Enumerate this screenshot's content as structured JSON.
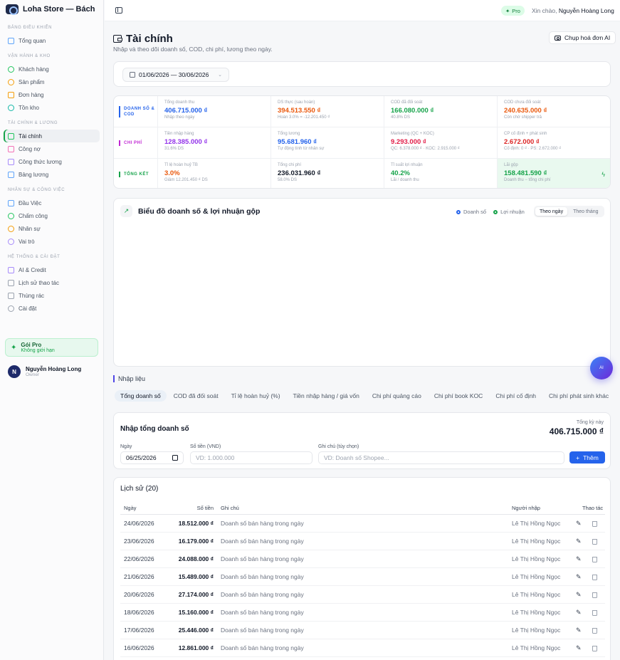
{
  "brand": {
    "name": "Loha Store — Bách hóa ..."
  },
  "sidebar": {
    "sections": [
      {
        "title": "Bảng điều khiển",
        "items": [
          {
            "label": "Tổng quan",
            "icon": "layout-grid-icon"
          }
        ]
      },
      {
        "title": "Vận hành & kho",
        "items": [
          {
            "label": "Khách hàng",
            "icon": "users-icon"
          },
          {
            "label": "Sản phẩm",
            "icon": "box-icon"
          },
          {
            "label": "Đơn hàng",
            "icon": "shopping-bag-icon"
          },
          {
            "label": "Tồn kho",
            "icon": "warehouse-icon"
          }
        ]
      },
      {
        "title": "Tài chính & lương",
        "items": [
          {
            "label": "Tài chính",
            "icon": "wallet-icon",
            "active": true
          },
          {
            "label": "Công nợ",
            "icon": "credit-card-icon"
          },
          {
            "label": "Công thức lương",
            "icon": "calculator-icon"
          },
          {
            "label": "Bảng lương",
            "icon": "receipt-icon"
          }
        ]
      },
      {
        "title": "Nhân sự & công việc",
        "items": [
          {
            "label": "Đầu Việc",
            "icon": "checkbox-icon"
          },
          {
            "label": "Chấm công",
            "icon": "clock-icon"
          },
          {
            "label": "Nhân sự",
            "icon": "user-icon"
          },
          {
            "label": "Vai trò",
            "icon": "shield-icon"
          }
        ]
      },
      {
        "title": "Hệ thống & cài đặt",
        "items": [
          {
            "label": "AI & Credit",
            "icon": "sparkle-icon"
          },
          {
            "label": "Lịch sử thao tác",
            "icon": "history-icon"
          },
          {
            "label": "Thùng rác",
            "icon": "trash-icon"
          },
          {
            "label": "Cài đặt",
            "icon": "gear-icon"
          }
        ]
      }
    ],
    "pro": {
      "title": "Gói Pro",
      "subtitle": "Không giới hạn"
    },
    "user": {
      "initial": "N",
      "name": "Nguyễn Hoàng Long",
      "role": "Owner"
    }
  },
  "topbar": {
    "badge": "Pro",
    "greeting": "Xin chào,",
    "username": "Nguyễn Hoàng Long"
  },
  "page": {
    "title": "Tài chính",
    "subtitle": "Nhập và theo dõi doanh số, COD, chi phí, lương theo ngày.",
    "ai_button": "Chụp hoá đơn AI",
    "date_range": "01/06/2026 — 30/06/2026"
  },
  "summary": [
    {
      "label": "Doanh số & COD",
      "color": "#2563eb",
      "cells": [
        {
          "label": "Tổng doanh thu",
          "value": "406.715.000 ₫",
          "note": "Nhập theo ngày",
          "color": "#2563eb"
        },
        {
          "label": "DS thực (sau hoàn)",
          "value": "394.513.550 ₫",
          "note": "Hoàn 3.0% = -12.201.450 ₫",
          "color": "#ea580c"
        },
        {
          "label": "COD đã đối soát",
          "value": "166.080.000 ₫",
          "note": "40.8% DS",
          "color": "#16a34a"
        },
        {
          "label": "COD chưa đối soát",
          "value": "240.635.000 ₫",
          "note": "Còn chờ shipper trả",
          "color": "#ea580c"
        }
      ]
    },
    {
      "label": "Chi phí",
      "color": "#c026d3",
      "cells": [
        {
          "label": "Tiền nhập hàng",
          "value": "128.385.000 ₫",
          "note": "31.6% DS",
          "color": "#9333ea"
        },
        {
          "label": "Tổng lương",
          "value": "95.681.960 ₫",
          "note": "Tự động tính từ nhân sự",
          "color": "#2563eb"
        },
        {
          "label": "Marketing (QC + KOC)",
          "value": "9.293.000 ₫",
          "note": "QC: 6.378.000 ₫ · KOC: 2.915.000 ₫",
          "color": "#e11d48"
        },
        {
          "label": "CP cố định + phát sinh",
          "value": "2.672.000 ₫",
          "note": "Cố định: 0 ₫ · PS: 2.672.000 ₫",
          "color": "#dc2626"
        }
      ]
    },
    {
      "label": "Tổng kết",
      "color": "#16a34a",
      "cells": [
        {
          "label": "Tỉ lệ hoàn huỷ TB",
          "value": "3.0%",
          "note": "Giảm 12.201.450 ₫ DS",
          "color": "#ea580c"
        },
        {
          "label": "Tổng chi phí",
          "value": "236.031.960 ₫",
          "note": "58.0% DS",
          "color": "#111827"
        },
        {
          "label": "Tỉ suất lợi nhuận",
          "value": "40.2%",
          "note": "Lãi / doanh thu",
          "color": "#16a34a"
        },
        {
          "label": "Lãi gộp",
          "value": "158.481.590 ₫",
          "note": "Doanh thu − tổng chi phí",
          "color": "#16a34a"
        }
      ]
    }
  ],
  "chart": {
    "title": "Biểu đồ doanh số & lợi nhuận gộp",
    "legend": [
      {
        "name": "Doanh số",
        "color": "#2563eb"
      },
      {
        "name": "Lợi nhuận",
        "color": "#16a34a"
      }
    ],
    "toggle": [
      "Theo ngày",
      "Theo tháng"
    ]
  },
  "fab": {
    "label": "AI"
  },
  "entry": {
    "section": "Nhập liệu",
    "tabs": [
      "Tổng doanh số",
      "COD đã đối soát",
      "Tỉ lệ hoàn huỷ (%)",
      "Tiền nhập hàng / giá vốn",
      "Chi phí quảng cáo",
      "Chi phí book KOC",
      "Chi phí cố định",
      "Chi phí phát sinh khác"
    ],
    "form_title": "Nhập tổng doanh số",
    "total_label": "Tổng kỳ này",
    "total_value": "406.715.000 ₫",
    "date_label": "Ngày",
    "date_value": "06/25/2026",
    "amount_label": "Số tiền (VND)",
    "amount_placeholder": "VD: 1.000.000",
    "note_label": "Ghi chú (tùy chọn)",
    "note_placeholder": "VD: Doanh số Shopee...",
    "add_button": "Thêm"
  },
  "history": {
    "title": "Lịch sử (20)",
    "columns": [
      "Ngày",
      "Số tiền",
      "Ghi chú",
      "Người nhập",
      "Thao tác"
    ],
    "rows": [
      {
        "date": "24/06/2026",
        "amount": "18.512.000 ₫",
        "note": "Doanh số bán hàng trong ngày",
        "user": "Lê Thị Hồng Ngọc"
      },
      {
        "date": "23/06/2026",
        "amount": "16.179.000 ₫",
        "note": "Doanh số bán hàng trong ngày",
        "user": "Lê Thị Hồng Ngọc"
      },
      {
        "date": "22/06/2026",
        "amount": "24.088.000 ₫",
        "note": "Doanh số bán hàng trong ngày",
        "user": "Lê Thị Hồng Ngọc"
      },
      {
        "date": "21/06/2026",
        "amount": "15.489.000 ₫",
        "note": "Doanh số bán hàng trong ngày",
        "user": "Lê Thị Hồng Ngọc"
      },
      {
        "date": "20/06/2026",
        "amount": "27.174.000 ₫",
        "note": "Doanh số bán hàng trong ngày",
        "user": "Lê Thị Hồng Ngọc"
      },
      {
        "date": "18/06/2026",
        "amount": "15.160.000 ₫",
        "note": "Doanh số bán hàng trong ngày",
        "user": "Lê Thị Hồng Ngọc"
      },
      {
        "date": "17/06/2026",
        "amount": "25.446.000 ₫",
        "note": "Doanh số bán hàng trong ngày",
        "user": "Lê Thị Hồng Ngọc"
      },
      {
        "date": "16/06/2026",
        "amount": "12.861.000 ₫",
        "note": "Doanh số bán hàng trong ngày",
        "user": "Lê Thị Hồng Ngọc"
      }
    ]
  }
}
